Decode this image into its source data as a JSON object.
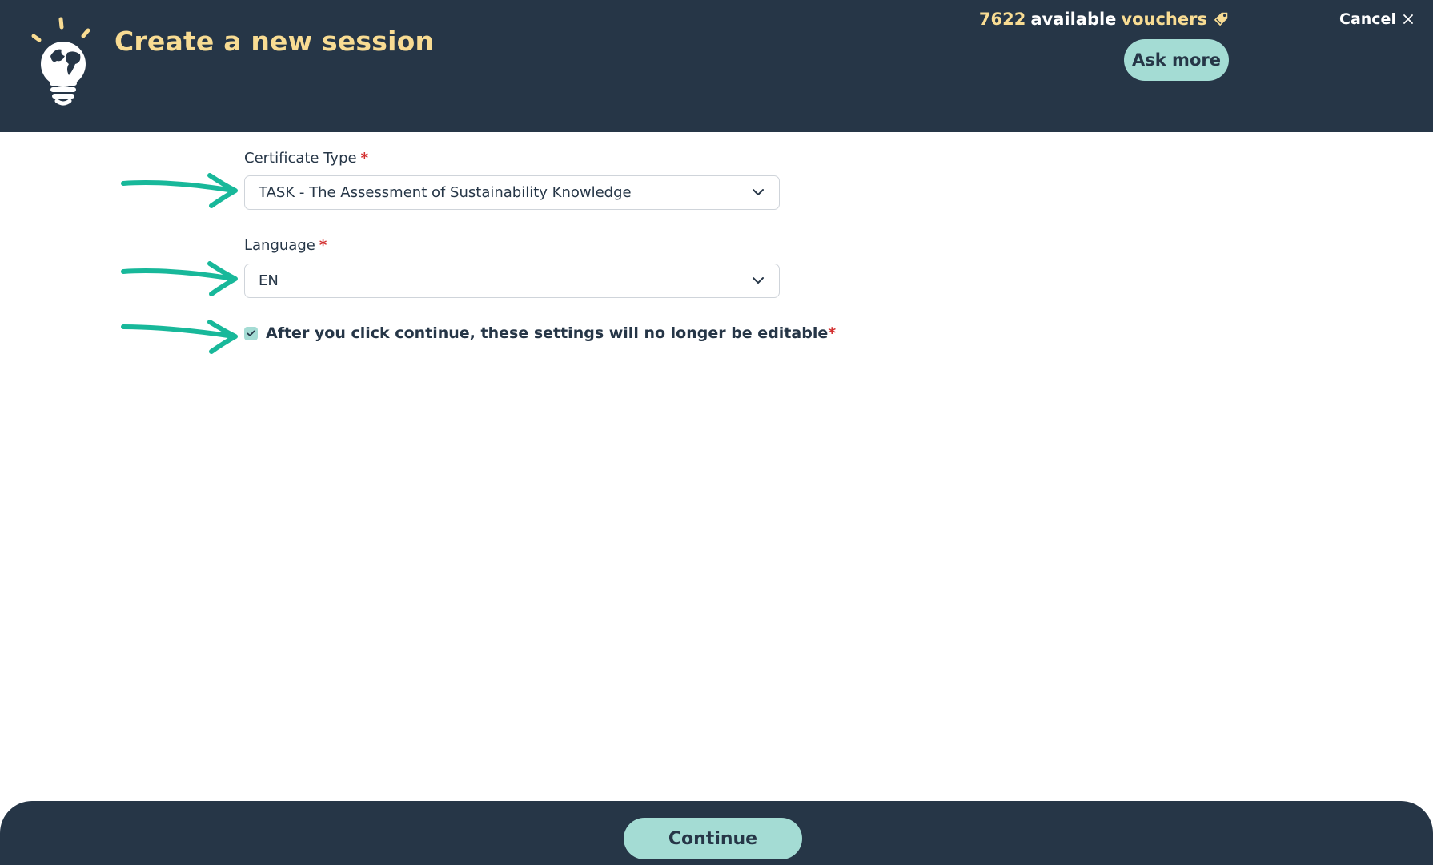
{
  "header": {
    "title": "Create a new session",
    "vouchers": {
      "count": "7622",
      "available_text": "available",
      "vouchers_text": "vouchers"
    },
    "ask_more_label": "Ask more",
    "cancel_label": "Cancel"
  },
  "form": {
    "certificate_type": {
      "label": "Certificate Type",
      "required_mark": "*",
      "value": "TASK - The Assessment of Sustainability Knowledge"
    },
    "language": {
      "label": "Language",
      "required_mark": "*",
      "value": "EN"
    },
    "confirmation": {
      "checked": true,
      "label": "After you click continue, these settings will no longer be editable",
      "required_mark": "*"
    }
  },
  "footer": {
    "continue_label": "Continue"
  },
  "icons": {
    "logo": "lightbulb-globe-icon",
    "voucher": "tag-icon",
    "cancel": "close-icon",
    "dropdown": "chevron-down-icon",
    "annotation": "arrow-right-icon"
  },
  "colors": {
    "header_bg": "#263647",
    "accent_yellow": "#f8dc93",
    "button_teal": "#a4dcd4",
    "arrow_green": "#18b89a",
    "required_red": "#d32f2f"
  }
}
